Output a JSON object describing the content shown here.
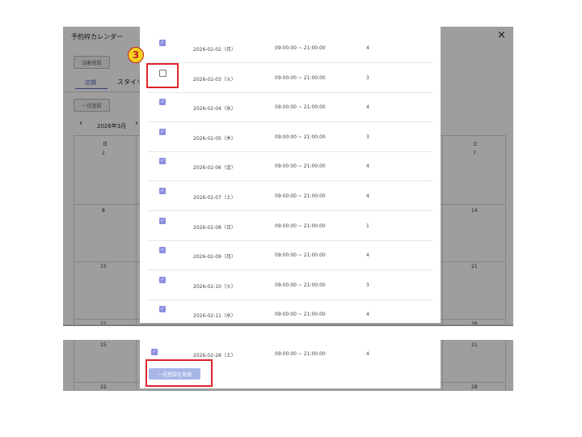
{
  "app": {
    "title": "予約枠カレンダー",
    "close_icon": "×"
  },
  "toolbar": {
    "auto_register_label": "自動登録",
    "bulk_register_label": "一括登録"
  },
  "tabs": [
    {
      "label": "店舗"
    },
    {
      "label": "スタイリ"
    }
  ],
  "calendar": {
    "month_label": "2026年3月",
    "prev_icon": "‹",
    "next_icon": "›",
    "weekday_first": "日",
    "weekday_last": "土",
    "top_left_dates": [
      "1",
      "8",
      "15",
      "22"
    ],
    "top_right_dates": [
      "7",
      "14",
      "21",
      "28"
    ],
    "bottom_left_dates": [
      "15",
      "22"
    ],
    "bottom_right_dates": [
      "21",
      "28"
    ]
  },
  "modal": {
    "rows": [
      {
        "checked": true,
        "date": "2026-02-02（月）",
        "time": "09:00:00 ~ 21:00:00",
        "count": "4"
      },
      {
        "checked": false,
        "date": "2026-02-03（火）",
        "time": "09:00:00 ~ 21:00:00",
        "count": "3"
      },
      {
        "checked": true,
        "date": "2026-02-04（水）",
        "time": "09:00:00 ~ 21:00:00",
        "count": "4"
      },
      {
        "checked": true,
        "date": "2026-02-05（木）",
        "time": "09:00:00 ~ 21:00:00",
        "count": "3"
      },
      {
        "checked": true,
        "date": "2026-02-06（金）",
        "time": "09:00:00 ~ 21:00:00",
        "count": "4"
      },
      {
        "checked": true,
        "date": "2026-02-07（土）",
        "time": "09:00:00 ~ 21:00:00",
        "count": "4"
      },
      {
        "checked": true,
        "date": "2026-02-08（日）",
        "time": "09:00:00 ~ 21:00:00",
        "count": "1"
      },
      {
        "checked": true,
        "date": "2026-02-09（月）",
        "time": "09:00:00 ~ 21:00:00",
        "count": "4"
      },
      {
        "checked": true,
        "date": "2026-02-10（火）",
        "time": "09:00:00 ~ 21:00:00",
        "count": "3"
      },
      {
        "checked": true,
        "date": "2026-02-11（水）",
        "time": "09:00:00 ~ 21:00:00",
        "count": "4"
      }
    ],
    "last_row": {
      "checked": true,
      "date": "2026-02-28（土）",
      "time": "09:00:00 ~ 21:00:00",
      "count": "4"
    },
    "execute_label": "一括登録を実施"
  },
  "annotation": {
    "step_number": "3"
  }
}
